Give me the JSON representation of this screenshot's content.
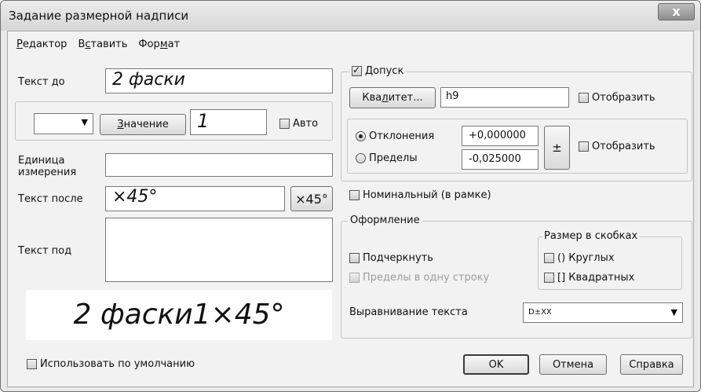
{
  "window": {
    "title": "Задание размерной надписи",
    "close_glyph": "x"
  },
  "menu": [
    {
      "pre": "",
      "u": "Р",
      "post": "едактор"
    },
    {
      "pre": "В",
      "u": "с",
      "post": "тавить"
    },
    {
      "pre": "Фор",
      "u": "м",
      "post": "ат"
    }
  ],
  "left": {
    "text_before_label": "Текст до",
    "text_before_value": "2 фаски",
    "symbol_dropdown_value": "",
    "value_button": {
      "u": "З",
      "post": "начение"
    },
    "value_field": "1",
    "auto_label": "Авто",
    "auto_checked": false,
    "unit_label_1": "Единица",
    "unit_label_2": "измерения",
    "unit_value": "",
    "text_after_label": "Текст после",
    "text_after_value": "×45°",
    "x45_button": "×45°",
    "text_under_label": "Текст под",
    "text_under_value": "",
    "preview": "2 фаски1×45°",
    "use_default_label": "Использовать по умолчанию",
    "use_default_checked": false
  },
  "tolerance": {
    "label": "Допуск",
    "checked": true,
    "qualitet_button": {
      "pre": "Ква",
      "u": "л",
      "post": "итет..."
    },
    "qualitet_value": "h9",
    "display_label": "Отобразить",
    "display_checked": false,
    "deviations_label": "Отклонения",
    "deviations_selected": true,
    "limits_label": "Пределы",
    "limits_selected": false,
    "upper_value": "+0,000000",
    "lower_value": "-0,025000",
    "pm_button": "±",
    "display2_label": "Отобразить",
    "display2_checked": false
  },
  "nominal": {
    "label": "Номинальный (в рамке)",
    "checked": false
  },
  "formatting": {
    "label": "Оформление",
    "underline_label": "Подчеркнуть",
    "underline_checked": false,
    "one_line_label": "Пределы в одну строку",
    "one_line_checked": false,
    "brackets_label": "Размер в скобках",
    "round_label": "() Круглых",
    "round_checked": false,
    "square_label": "[] Квадратных",
    "square_checked": false,
    "align_label": "Выравнивание текста",
    "align_value": "D±XX"
  },
  "footer": {
    "ok": "OK",
    "cancel": "Отмена",
    "help": "Справка"
  }
}
